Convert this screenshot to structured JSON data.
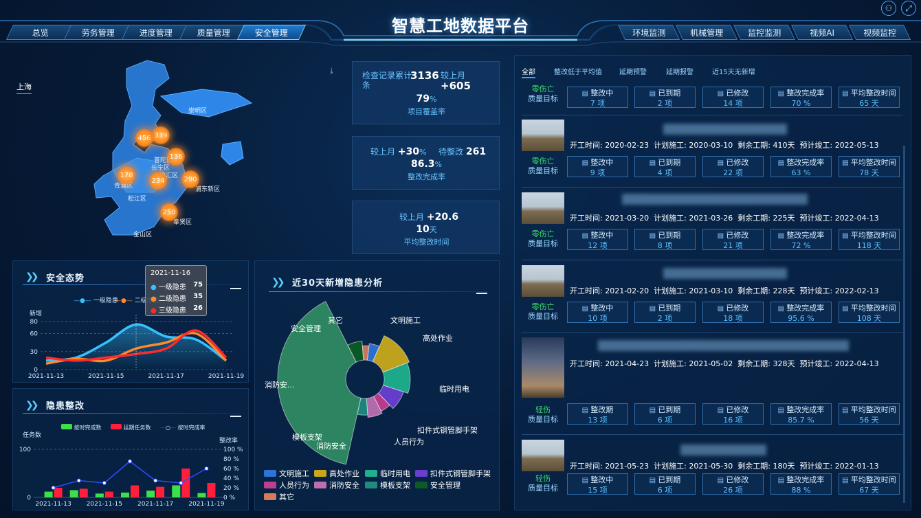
{
  "header": {
    "title": "智慧工地数据平台",
    "left_tabs": [
      "总览",
      "劳务管理",
      "进度管理",
      "质量管理",
      "安全管理"
    ],
    "active_tab": "安全管理",
    "right_tabs": [
      "环境监测",
      "机械管理",
      "监控监测",
      "视频AI",
      "视频监控"
    ],
    "icons": [
      "org-chart-icon",
      "fullscreen-icon"
    ]
  },
  "map": {
    "city_label": "上海",
    "districts": [
      "崇明区",
      "普陀区",
      "长宁区",
      "徐汇区",
      "松江区",
      "浦东新区",
      "青浦区",
      "奉贤区",
      "金山区"
    ],
    "bubbles": [
      456,
      339,
      136,
      178,
      234,
      290,
      250
    ]
  },
  "kpis": {
    "k1": {
      "label": "检查记录累计",
      "value": "3136",
      "unit": "条",
      "mom_label": "较上月",
      "mom": "+605",
      "rate": "79",
      "rate_unit": "%",
      "rate_label": "项目覆盖率"
    },
    "k2": {
      "mom_label": "较上月",
      "mom": "+30",
      "mom_unit": "%",
      "pending_label": "待整改",
      "pending": "261",
      "rate": "86.3",
      "rate_unit": "%",
      "rate_label": "整改完成率"
    },
    "k3": {
      "mom_label": "较上月",
      "mom": "+20.6",
      "value": "10",
      "unit": "天",
      "label": "平均整改时间"
    }
  },
  "safety_trend": {
    "title": "安全态势",
    "legend": [
      "一级隐患",
      "二级隐患"
    ],
    "ylabel": "新增",
    "tooltip": {
      "date": "2021-11-16",
      "rows": [
        {
          "name": "一级隐患",
          "value": "75",
          "color": "#37c2ff"
        },
        {
          "name": "二级隐患",
          "value": "35",
          "color": "#ff8a2b"
        },
        {
          "name": "三级隐患",
          "value": "26",
          "color": "#ff2b2b"
        }
      ]
    }
  },
  "rectify": {
    "title": "隐患整改",
    "legend": [
      "按时完成数",
      "延期任务数",
      "按时完成率"
    ],
    "ylabel_left": "任务数",
    "ylabel_right": "整改率"
  },
  "analysis": {
    "title": "近30天新增隐患分析",
    "slice_labels": [
      "其它",
      "文明施工",
      "高处作业",
      "临时用电",
      "扣件式钢管脚手架",
      "人员行为",
      "消防安全",
      "模板支架",
      "消防安...",
      "安全管理"
    ]
  },
  "chart_data": [
    {
      "type": "line",
      "title": "安全态势",
      "ylabel": "新增",
      "x_ticks": [
        "2021-11-13",
        "2021-11-15",
        "2021-11-17",
        "2021-11-19"
      ],
      "ylim": [
        0,
        80
      ],
      "y_ticks": [
        0,
        30,
        60,
        80
      ],
      "x": [
        "2021-11-13",
        "2021-11-14",
        "2021-11-15",
        "2021-11-16",
        "2021-11-17",
        "2021-11-18",
        "2021-11-19"
      ],
      "series": [
        {
          "name": "一级隐患",
          "color": "#37c2ff",
          "values": [
            15,
            20,
            45,
            75,
            55,
            50,
            15
          ]
        },
        {
          "name": "二级隐患",
          "color": "#ff8a2b",
          "values": [
            10,
            18,
            15,
            35,
            45,
            60,
            15
          ]
        },
        {
          "name": "三级隐患",
          "color": "#ff2b2b",
          "values": [
            20,
            15,
            20,
            26,
            35,
            65,
            20
          ]
        }
      ]
    },
    {
      "type": "bar",
      "title": "隐患整改",
      "ylabel": "任务数",
      "ylabel_right": "整改率",
      "x_ticks": [
        "2021-11-13",
        "2021-11-15",
        "2021-11-17",
        "2021-11-19"
      ],
      "ylim": [
        0,
        100
      ],
      "y_ticks": [
        0,
        100
      ],
      "y2lim": [
        0,
        100
      ],
      "y2_ticks": [
        "0 %",
        "20 %",
        "40 %",
        "60 %",
        "80 %",
        "100 %"
      ],
      "categories": [
        "2021-11-13",
        "2021-11-14",
        "2021-11-15",
        "2021-11-16",
        "2021-11-17",
        "2021-11-18",
        "2021-11-19"
      ],
      "series": [
        {
          "name": "按时完成数",
          "color": "#3ee04a",
          "values": [
            12,
            15,
            8,
            10,
            14,
            25,
            9
          ]
        },
        {
          "name": "延期任务数",
          "color": "#ff1f3d",
          "values": [
            20,
            18,
            12,
            25,
            22,
            60,
            30
          ]
        },
        {
          "name": "按时完成率",
          "color": "#2e4dff",
          "type": "line",
          "values": [
            20,
            35,
            30,
            75,
            35,
            30,
            60
          ]
        }
      ]
    },
    {
      "type": "pie",
      "title": "近30天新增隐患分析",
      "variant": "rose",
      "slices": [
        {
          "name": "文明施工",
          "value": 3,
          "color": "#2f73d8"
        },
        {
          "name": "高处作业",
          "value": 8,
          "color": "#c8a81a"
        },
        {
          "name": "临时用电",
          "value": 7,
          "color": "#1fb08e"
        },
        {
          "name": "扣件式钢管脚手架",
          "value": 5,
          "color": "#6a3fd0"
        },
        {
          "name": "人员行为",
          "value": 3,
          "color": "#c03e8e"
        },
        {
          "name": "消防安全",
          "value": 4,
          "color": "#bb6fb0"
        },
        {
          "name": "模板支架",
          "value": 3,
          "color": "#1f8a7e"
        },
        {
          "name": "消防安全",
          "value": 25,
          "color": "#2e8a62"
        },
        {
          "name": "安全管理",
          "value": 4,
          "color": "#0c5a24"
        },
        {
          "name": "其它",
          "value": 2,
          "color": "#d67a5a"
        }
      ],
      "legend": [
        "文明施工",
        "高处作业",
        "临时用电",
        "扣件式钢管脚手架",
        "人员行为",
        "消防安全",
        "模板支架",
        "安全管理",
        "其它"
      ]
    }
  ],
  "projects": {
    "filters": [
      "全部",
      "整改低于平均值",
      "延期预警",
      "延期报警",
      "近15天无新增"
    ],
    "stat_labels": [
      "整改中",
      "已到期",
      "已修改",
      "整改完成率",
      "平均整改时间"
    ],
    "stat_labels_alt": [
      "整改期",
      "已到期",
      "已修改",
      "整改完成率",
      "平均整改时间"
    ],
    "labels": {
      "start": "开工时间:",
      "plan": "计划施工:",
      "remain": "剩余工期:",
      "finish": "预计竣工:"
    },
    "items": [
      {
        "goal1": "零伤亡",
        "goal2": "质量目标",
        "goal_color": "green",
        "stats": [
          "7 项",
          "2 项",
          "14 项",
          "70 %",
          "65 天"
        ]
      },
      {
        "start": "2020-02-23",
        "plan": "2020-03-10",
        "remain": "410天",
        "finish": "2022-05-13",
        "goal1": "零伤亡",
        "goal2": "质量目标",
        "goal_color": "green",
        "stats": [
          "9 项",
          "4 项",
          "22 项",
          "63 %",
          "78 天"
        ]
      },
      {
        "start": "2021-03-20",
        "plan": "2021-03-26",
        "remain": "225天",
        "finish": "2022-04-13",
        "goal1": "零伤亡",
        "goal2": "质量目标",
        "goal_color": "green",
        "stats": [
          "12 项",
          "8 项",
          "21 项",
          "72 %",
          "118 天"
        ]
      },
      {
        "start": "2021-02-20",
        "plan": "2021-03-10",
        "remain": "228天",
        "finish": "2022-02-13",
        "goal1": "零伤亡",
        "goal2": "质量目标",
        "goal_color": "green",
        "stats": [
          "10 项",
          "2 项",
          "18 项",
          "95.6 %",
          "108 天"
        ]
      },
      {
        "start": "2021-04-23",
        "plan": "2021-05-02",
        "remain": "328天",
        "finish": "2022-04-13",
        "goal1": "轻伤",
        "goal2": "质量目标",
        "goal_color": "green",
        "stats": [
          "13 项",
          "6 项",
          "16 项",
          "85.7 %",
          "56 天"
        ]
      },
      {
        "start": "2021-05-23",
        "plan": "2021-05-30",
        "remain": "180天",
        "finish": "2022-01-13",
        "goal1": "轻伤",
        "goal2": "质量目标",
        "goal_color": "green",
        "stats": [
          "15 项",
          "6 项",
          "26 项",
          "88 %",
          "67 天"
        ]
      }
    ]
  }
}
